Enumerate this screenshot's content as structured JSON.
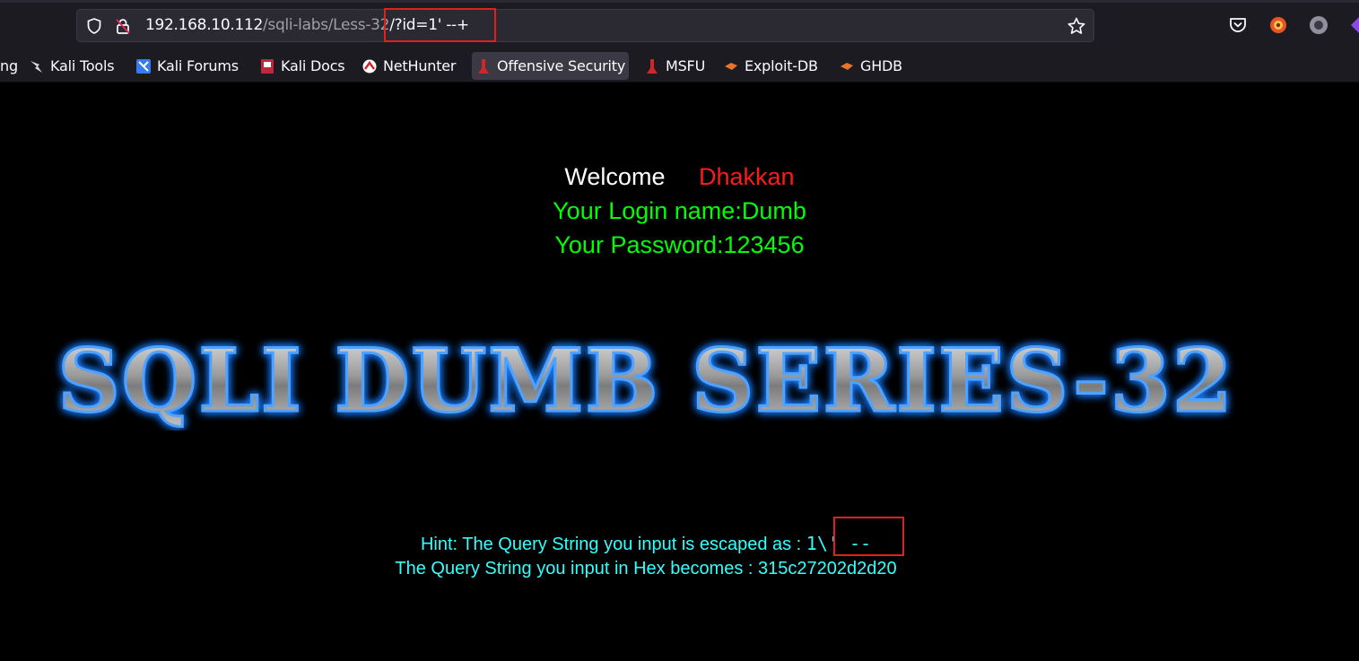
{
  "browser": {
    "url": {
      "host": "192.168.10.112",
      "path": "/sqli-labs/Less-32",
      "query": "/?id=1' --+"
    },
    "icons": {
      "shield": "shield-icon",
      "lock": "insecure-lock-icon",
      "star": "bookmark-star-icon",
      "pocket": "pocket-icon",
      "extension": "extension-icon",
      "profile": "account-icon"
    },
    "bookmarks": [
      {
        "label": "ng",
        "icon": ""
      },
      {
        "label": "Kali Tools",
        "icon": "kali-tools-icon"
      },
      {
        "label": "Kali Forums",
        "icon": "kali-forums-icon"
      },
      {
        "label": "Kali Docs",
        "icon": "kali-docs-icon"
      },
      {
        "label": "NetHunter",
        "icon": "nethunter-icon"
      },
      {
        "label": "Offensive Security",
        "icon": "offsec-icon"
      },
      {
        "label": "MSFU",
        "icon": "msfu-icon"
      },
      {
        "label": "Exploit-DB",
        "icon": "exploit-db-icon"
      },
      {
        "label": "GHDB",
        "icon": "ghdb-icon"
      }
    ]
  },
  "page": {
    "welcome": "Welcome",
    "user": "Dhakkan",
    "login_line": "Your Login name:Dumb",
    "password_line": "Your Password:123456",
    "banner": "SQLI DUMB SERIES-32",
    "hint_prefix": "Hint: The Query String you input is escaped as : ",
    "hint_value": "1\\' --",
    "hex_line": "The Query String you input in Hex becomes : 315c27202d2d20"
  },
  "colors": {
    "background": "#000000",
    "welcome": "#ffffff",
    "user": "#ff1a1a",
    "credentials": "#00ff00",
    "hint": "#33ffff",
    "highlight_box": "#e0201c",
    "banner_glow": "#1e7bff"
  }
}
